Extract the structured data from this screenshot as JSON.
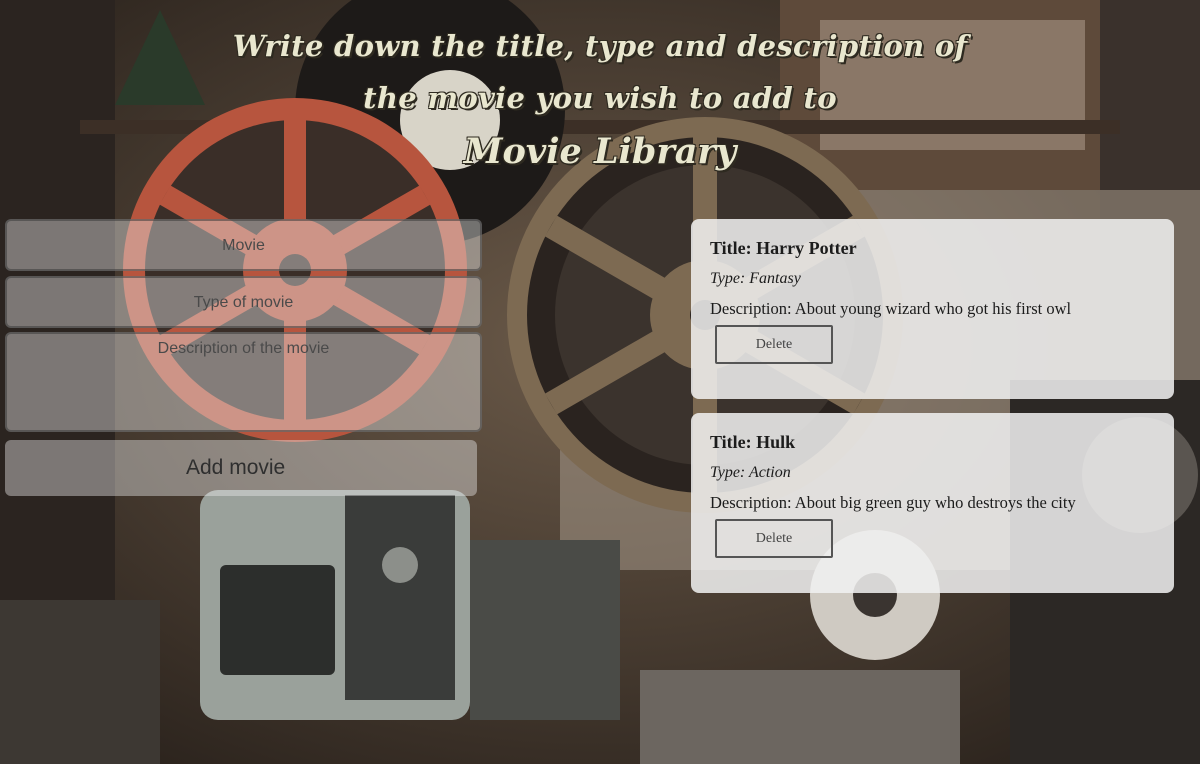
{
  "heading": {
    "line1": "Write down the title, type and description of",
    "line2": "the movie you wish to add to",
    "brand": "Movie Library"
  },
  "form": {
    "movie_placeholder": "Movie",
    "type_placeholder": "Type of movie",
    "description_placeholder": "Description of the movie",
    "add_label": "Add movie"
  },
  "movies": [
    {
      "title": "Title: Harry Potter",
      "type": "Type: Fantasy",
      "description": "Description: About young wizard who got his first owl",
      "delete_label": "Delete"
    },
    {
      "title": "Title: Hulk",
      "type": "Type: Action",
      "description": "Description: About big green guy who destroys the city",
      "delete_label": "Delete"
    }
  ],
  "colors": {
    "heading_text": "#e9e7cf",
    "card_background": "#f1f1f1",
    "reel_red": "#b7553e",
    "reel_bronze": "#7d6a52"
  }
}
